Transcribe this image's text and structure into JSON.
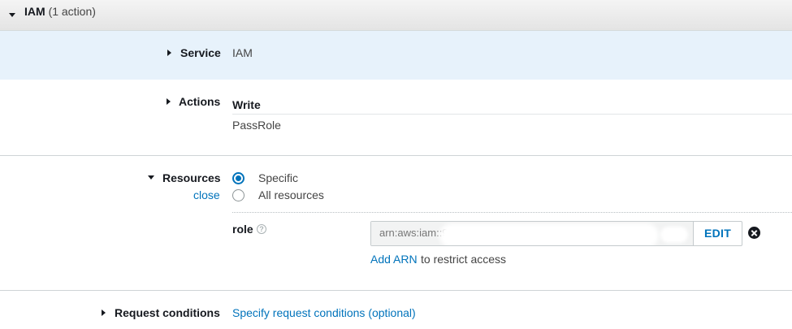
{
  "panel": {
    "title": "IAM",
    "count": "(1 action)"
  },
  "service": {
    "label": "Service",
    "value": "IAM"
  },
  "actions": {
    "label": "Actions",
    "group": "Write",
    "item": "PassRole"
  },
  "resources": {
    "label": "Resources",
    "close": "close",
    "options": [
      {
        "label": "Specific",
        "checked": true
      },
      {
        "label": "All resources",
        "checked": false
      }
    ],
    "role_label": "role",
    "help_glyph": "?",
    "arn_value": "arn:aws:iam::96 ...",
    "edit_label": "EDIT",
    "add_arn_link": "Add ARN",
    "add_arn_suffix": "to restrict access"
  },
  "request_conditions": {
    "label": "Request conditions",
    "link": "Specify request conditions (optional)"
  },
  "colors": {
    "link": "#0073bb",
    "service_row_bg": "#e7f2fb"
  }
}
